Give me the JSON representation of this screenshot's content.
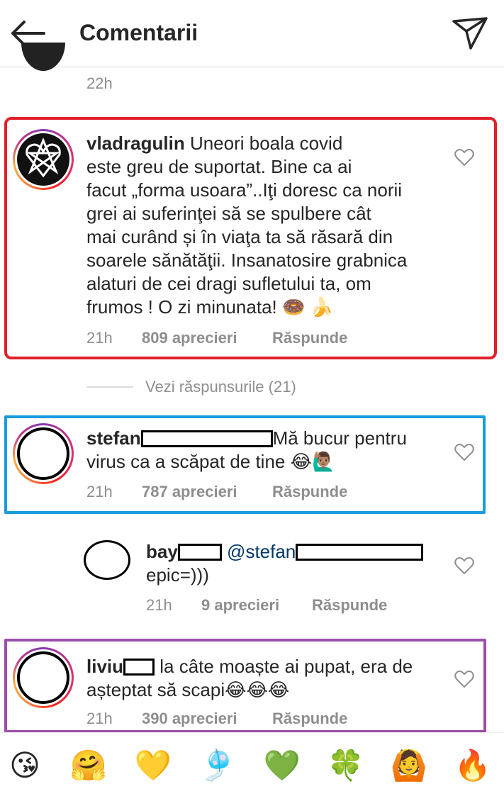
{
  "header": {
    "title": "Comentarii",
    "back_icon": "arrow-left-icon",
    "send_icon": "paper-plane-icon"
  },
  "prev_comment": {
    "time": "22h"
  },
  "comments": [
    {
      "username": "vladragulin",
      "lines": [
        "Uneori boala covid",
        "este greu de suportat. Bine ca ai",
        "facut „forma usoara”..Iţi doresc ca norii",
        "grei ai suferinţei să se spulbere cât",
        "mai curând și în viaţa ta să răsară din",
        "soarele sănătăţii. Insanatosire grabnica",
        "alaturi de cei dragi sufletului ta, om",
        "frumos ! O zi minunata! 🍩 🍌"
      ],
      "time": "21h",
      "likes": "809 aprecieri",
      "reply": "Răspunde",
      "frame_color": "#e0202a"
    },
    {
      "username": "stefan",
      "line1_after": "Mă bucur pentru",
      "line2": "virus ca a scăpat de tine 😂🙋🏽‍♂️",
      "time": "21h",
      "likes": "787 aprecieri",
      "reply": "Răspunde",
      "frame_color": "#1a9be0"
    },
    {
      "username": "liviu",
      "line1_after": "la câte moaște ai pupat, era de",
      "line2": "așteptat să scapi😂😂😂",
      "time": "21h",
      "likes": "390 aprecieri",
      "reply": "Răspunde",
      "frame_color": "#9b4ea8"
    }
  ],
  "view_replies": "Vezi răspunsurile (21)",
  "reply_comment": {
    "username": "bay",
    "mention": "@stefan",
    "line2": "epic=)))",
    "time": "21h",
    "likes": "9 aprecieri",
    "reply": "Răspunde"
  },
  "emoji_bar": [
    "😘",
    "🤗",
    "💛",
    "🎐",
    "💚",
    "🍀",
    "🙆",
    "🔥"
  ]
}
